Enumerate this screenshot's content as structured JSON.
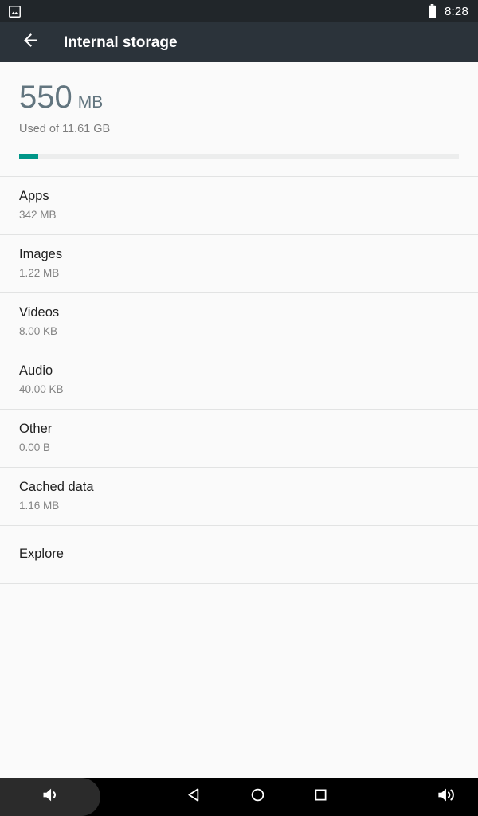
{
  "status_bar": {
    "notification_icon": "image-notification-icon",
    "battery_icon": "battery-full-icon",
    "clock": "8:28"
  },
  "app_bar": {
    "back_icon": "back-arrow-icon",
    "title": "Internal storage"
  },
  "summary": {
    "amount": "550",
    "unit": "MB",
    "used_of": "Used of 11.61 GB",
    "progress_percent": 4.4,
    "progress_color": "#009688",
    "track_color": "#eceded",
    "amount_color": "#62757f"
  },
  "list": {
    "items": [
      {
        "title": "Apps",
        "size": "342 MB"
      },
      {
        "title": "Images",
        "size": "1.22 MB"
      },
      {
        "title": "Videos",
        "size": "8.00 KB"
      },
      {
        "title": "Audio",
        "size": "40.00 KB"
      },
      {
        "title": "Other",
        "size": "0.00 B"
      },
      {
        "title": "Cached data",
        "size": "1.16 MB"
      },
      {
        "title": "Explore",
        "size": ""
      }
    ]
  },
  "nav_bar": {
    "volume_down_icon": "volume-down-icon",
    "back_icon": "nav-back-icon",
    "home_icon": "nav-home-icon",
    "recents_icon": "nav-recents-icon",
    "volume_up_icon": "volume-up-icon"
  }
}
